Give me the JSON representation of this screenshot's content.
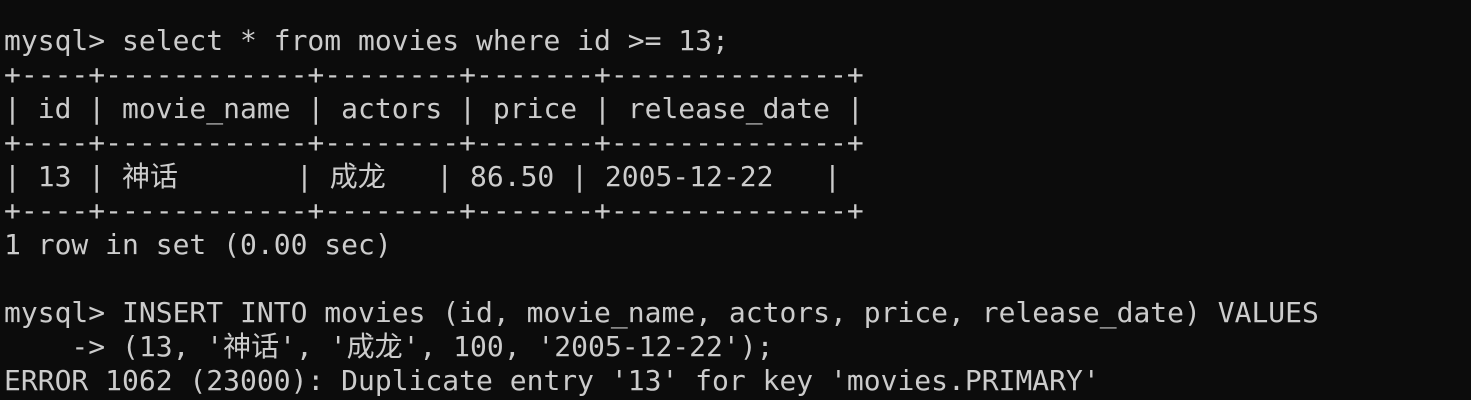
{
  "terminal": {
    "lines": [
      "mysql> select * from movies where id >= 13;",
      "+----+------------+--------+-------+--------------+",
      "| id | movie_name | actors | price | release_date |",
      "+----+------------+--------+-------+--------------+",
      "| 13 | 神话       | 成龙   | 86.50 | 2005-12-22   |",
      "+----+------------+--------+-------+--------------+",
      "1 row in set (0.00 sec)",
      "",
      "mysql> INSERT INTO movies (id, movie_name, actors, price, release_date) VALUES",
      "    -> (13, '神话', '成龙', 100, '2005-12-22');",
      "ERROR 1062 (23000): Duplicate entry '13' for key 'movies.PRIMARY'"
    ]
  }
}
